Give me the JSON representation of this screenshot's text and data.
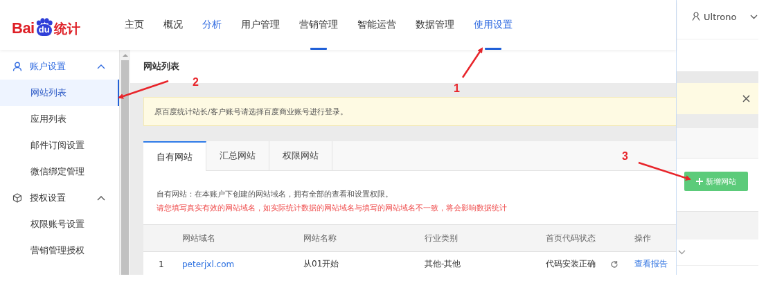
{
  "logo": {
    "brand": "Bai",
    "badge": "du",
    "product": "统计"
  },
  "nav": [
    {
      "label": "主页",
      "selected": false,
      "indicator": false
    },
    {
      "label": "概况",
      "selected": false,
      "indicator": false
    },
    {
      "label": "分析",
      "selected": true,
      "indicator": false
    },
    {
      "label": "用户管理",
      "selected": false,
      "indicator": false
    },
    {
      "label": "营销管理",
      "selected": false,
      "indicator": true
    },
    {
      "label": "智能运营",
      "selected": false,
      "indicator": false
    },
    {
      "label": "数据管理",
      "selected": false,
      "indicator": false
    },
    {
      "label": "使用设置",
      "selected": true,
      "indicator": true
    }
  ],
  "sidebar": {
    "groups": [
      {
        "label": "账户设置",
        "active": true,
        "expanded": true,
        "items": [
          {
            "label": "网站列表",
            "selected": true
          },
          {
            "label": "应用列表",
            "selected": false
          },
          {
            "label": "邮件订阅设置",
            "selected": false
          },
          {
            "label": "微信绑定管理",
            "selected": false
          }
        ]
      },
      {
        "label": "授权设置",
        "active": false,
        "expanded": true,
        "items": [
          {
            "label": "权限账号设置",
            "selected": false
          },
          {
            "label": "营销管理授权",
            "selected": false
          }
        ]
      }
    ]
  },
  "page_title": "网站列表",
  "notice": "原百度统计站长/客户账号请选择百度商业账号进行登录。",
  "tabs": [
    {
      "label": "自有网站",
      "selected": true
    },
    {
      "label": "汇总网站",
      "selected": false
    },
    {
      "label": "权限网站",
      "selected": false
    }
  ],
  "description": "自有网站：在本账户下创建的网站域名，拥有全部的查看和设置权限。",
  "warning": "请您填写真实有效的网站域名，如实际统计数据的网站域名与填写的网站域名不一致，将会影响数据统计",
  "table": {
    "columns": [
      {
        "label": "网站域名",
        "kind": "link"
      },
      {
        "label": "网站名称",
        "kind": "text"
      },
      {
        "label": "行业类别",
        "kind": "text"
      },
      {
        "label": "首页代码状态",
        "kind": "status"
      },
      {
        "label": "操作",
        "kind": "link"
      }
    ],
    "rows": [
      {
        "index": "1",
        "cells": [
          "peterjxl.com",
          "从01开始",
          "其他-其他",
          "代码安装正确",
          "查看报告"
        ]
      }
    ]
  },
  "background": {
    "user": "Ultrono",
    "add_button": "新增网站"
  },
  "annotations": [
    {
      "label": "1"
    },
    {
      "label": "2"
    },
    {
      "label": "3"
    }
  ]
}
